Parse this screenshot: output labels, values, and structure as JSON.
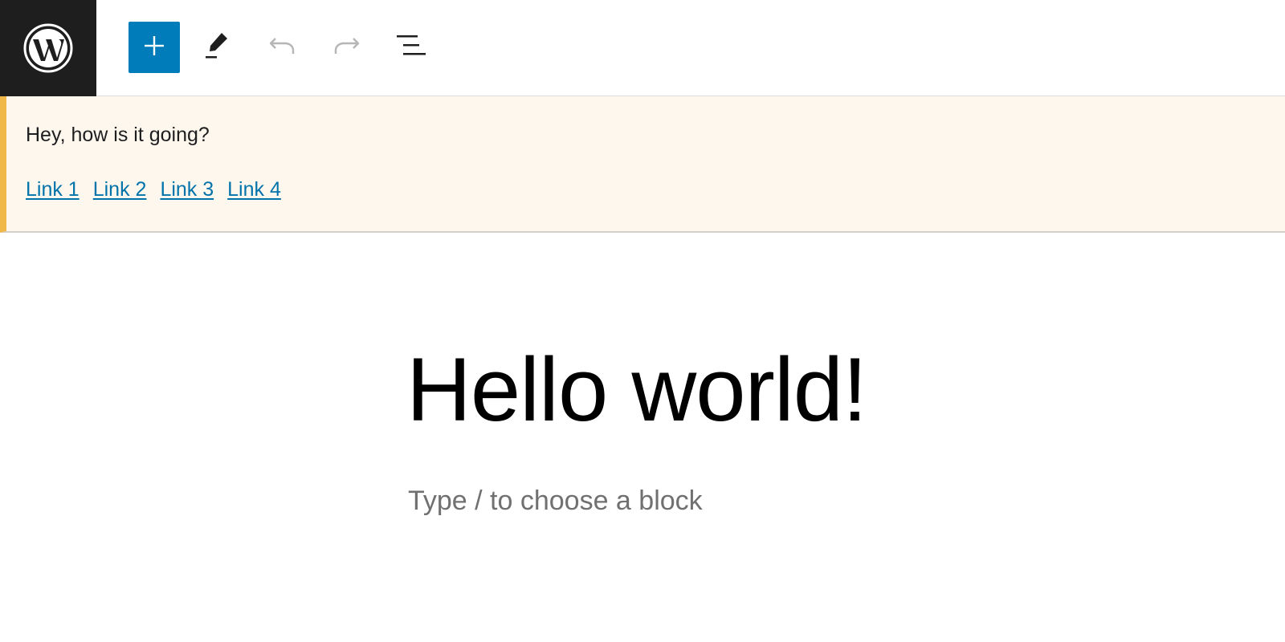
{
  "toolbar": {
    "logo_icon": "wordpress-logo-icon",
    "add_block_icon": "plus-icon",
    "edit_icon": "pencil-icon",
    "undo_icon": "undo-icon",
    "redo_icon": "redo-icon",
    "outline_icon": "list-view-icon",
    "accent_color": "#007cba",
    "logo_bg": "#1e1e1e"
  },
  "notice": {
    "message": "Hey, how is it going?",
    "links": [
      "Link 1",
      "Link 2",
      "Link 3",
      "Link 4"
    ],
    "bg_color": "#fef7ee",
    "border_color": "#f0b849",
    "link_color": "#0073aa"
  },
  "canvas": {
    "title": "Hello world!",
    "block_placeholder": "Type / to choose a block"
  }
}
